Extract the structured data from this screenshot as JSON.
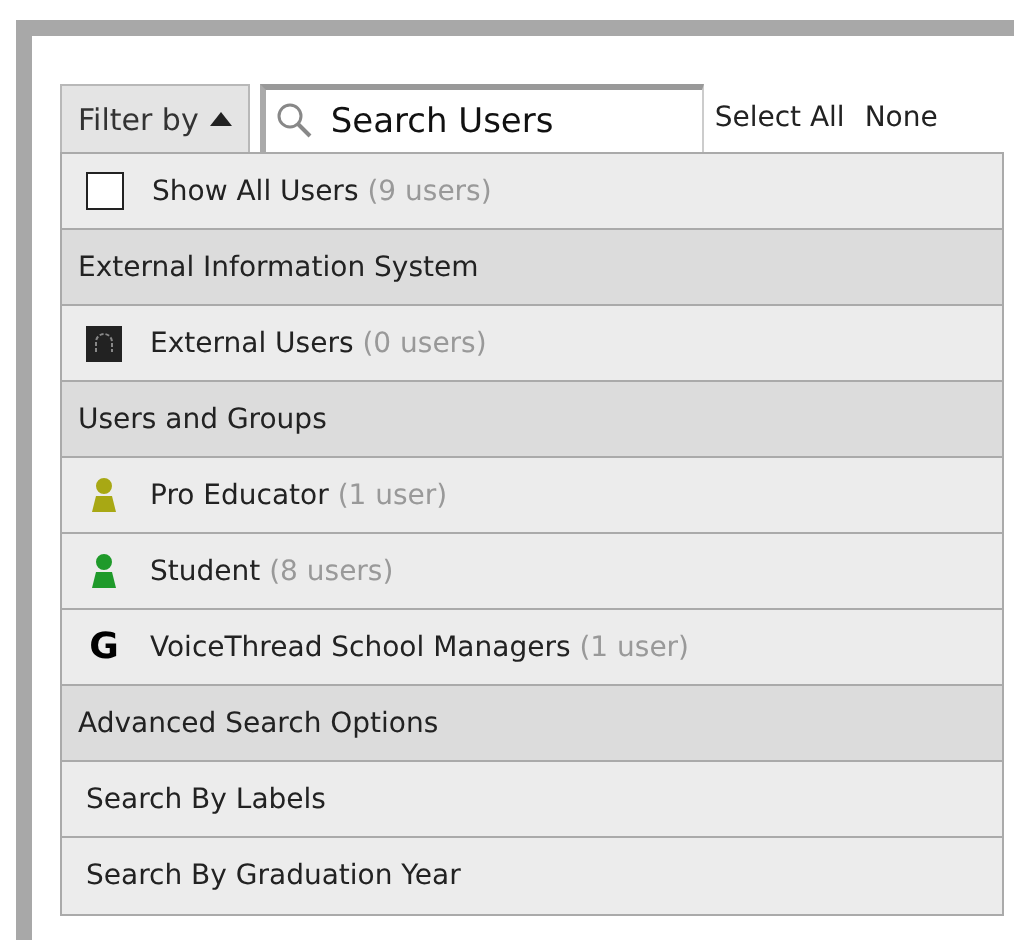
{
  "toolbar": {
    "filter_button": {
      "label": "Filter by",
      "expanded": true
    },
    "search": {
      "placeholder": "Search Users"
    },
    "select_all": "Select All",
    "select_none": "None"
  },
  "rows": [
    {
      "kind": "checkbox",
      "label": "Show All Users",
      "count": "(9 users)",
      "checked": false
    },
    {
      "kind": "header",
      "label": "External Information System"
    },
    {
      "kind": "external",
      "label": "External Users",
      "count": "(0 users)"
    },
    {
      "kind": "header",
      "label": "Users and Groups"
    },
    {
      "kind": "role",
      "color": "#a8a814",
      "label": "Pro Educator",
      "count": "(1 user)"
    },
    {
      "kind": "role",
      "color": "#1f9a2a",
      "label": "Student",
      "count": "(8 users)"
    },
    {
      "kind": "group",
      "glyph": "G",
      "label": "VoiceThread School Managers",
      "count": "(1 user)"
    },
    {
      "kind": "header",
      "label": "Advanced Search Options"
    },
    {
      "kind": "link",
      "label": "Search By Labels"
    },
    {
      "kind": "link",
      "label": "Search By Graduation Year"
    }
  ]
}
